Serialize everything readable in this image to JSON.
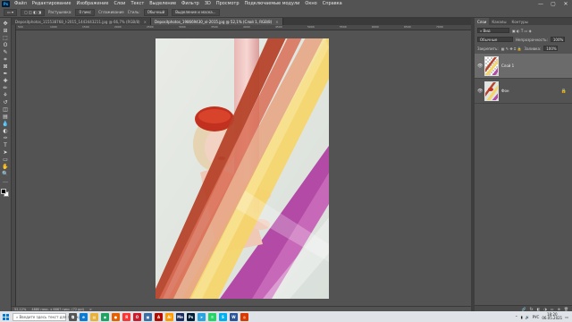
{
  "app": {
    "logo": "Ps"
  },
  "menu": [
    "Файл",
    "Редактирование",
    "Изображение",
    "Слои",
    "Текст",
    "Выделение",
    "Фильтр",
    "3D",
    "Просмотр",
    "Подключаемые модули",
    "Окно",
    "Справка"
  ],
  "window_controls": [
    "minimize-icon",
    "maximize-icon",
    "close-icon"
  ],
  "options": {
    "tool_icon": "move-icon",
    "feather_label": "Растушевка:",
    "feather_value": "0 пикс",
    "antialias_label": "Сглаживание",
    "style_label": "Стиль:",
    "style_value": "Обычный",
    "select_mask": "Выделение и маска..."
  },
  "tabs": [
    {
      "label": "Depositphotos_115538768_l-2015_1443443211.jpg @ 66,7% (RGB/8)",
      "active": false
    },
    {
      "label": "Depositphotos_198669430_xl-2015.jpg @ 52,1% (Слой 1, RGB/8)",
      "active": true
    }
  ],
  "ruler": [
    "500",
    "1000",
    "1500",
    "2000",
    "2500",
    "3000",
    "3500",
    "4000",
    "4500",
    "5000",
    "5500",
    "6000",
    "6500",
    "7000"
  ],
  "tools": [
    "move-icon",
    "artboard-icon",
    "marquee-icon",
    "lasso-icon",
    "quick-select-icon",
    "crop-icon",
    "frame-icon",
    "eyedropper-icon",
    "spot-heal-icon",
    "brush-icon",
    "stamp-icon",
    "history-brush-icon",
    "eraser-icon",
    "gradient-icon",
    "blur-icon",
    "dodge-icon",
    "pen-icon",
    "type-icon",
    "path-select-icon",
    "rectangle-icon",
    "hand-icon",
    "zoom-icon",
    "more-tools-icon"
  ],
  "tool_glyphs": [
    "✥",
    "⊞",
    "⬚",
    "ʘ",
    "✎",
    "⌗",
    "⊠",
    "✒",
    "✚",
    "✏",
    "⚘",
    "↺",
    "◫",
    "▤",
    "💧",
    "◐",
    "✑",
    "T",
    "➤",
    "▭",
    "✋",
    "🔍",
    "…"
  ],
  "status": {
    "zoom": "52,12%",
    "doc_size": "4880 пикс. x 6667 пикс. (72 ppi)",
    "arrow": ">"
  },
  "panel": {
    "tabs": [
      "Слои",
      "Каналы",
      "Контуры"
    ],
    "filter_label": "Вид",
    "blend_mode": "Обычные",
    "opacity_label": "Непрозрачность:",
    "opacity_value": "100%",
    "lock_label": "Закрепить:",
    "fill_label": "Заливка:",
    "fill_value": "100%",
    "layers": [
      {
        "name": "Слой 1",
        "selected": true,
        "locked": false
      },
      {
        "name": "Фон",
        "selected": false,
        "locked": true
      }
    ],
    "bottom_icons": [
      "link-icon",
      "fx-icon",
      "mask-icon",
      "adjustment-icon",
      "folder-icon",
      "new-layer-icon",
      "trash-icon"
    ],
    "bottom_glyphs": [
      "🔗",
      "fx",
      "◧",
      "◑",
      "▭",
      "⊕",
      "🗑"
    ]
  },
  "taskbar": {
    "search_placeholder": "Введите здесь текст для поиска",
    "apps": [
      {
        "icon": "task-view-icon",
        "letter": "⧉",
        "color": "#555555"
      },
      {
        "icon": "edge-icon",
        "letter": "e",
        "color": "#0c7bd1"
      },
      {
        "icon": "explorer-icon",
        "letter": "▤",
        "color": "#e8b23a"
      },
      {
        "icon": "chrome-icon",
        "letter": "◉",
        "color": "#1ea362"
      },
      {
        "icon": "firefox-icon",
        "letter": "●",
        "color": "#e66000"
      },
      {
        "icon": "yandex-icon",
        "letter": "Я",
        "color": "#ff3333"
      },
      {
        "icon": "opera-icon",
        "letter": "O",
        "color": "#cc1b2b"
      },
      {
        "icon": "files-icon",
        "letter": "▣",
        "color": "#3b6ea5"
      },
      {
        "icon": "acrobat-icon",
        "letter": "A",
        "color": "#b30b00"
      },
      {
        "icon": "illustrator-icon",
        "letter": "Ai",
        "color": "#ff9a00"
      },
      {
        "icon": "media-encoder-icon",
        "letter": "Me",
        "color": "#1b2e5f"
      },
      {
        "icon": "photoshop-icon",
        "letter": "Ps",
        "color": "#001e36"
      },
      {
        "icon": "telegram-icon",
        "letter": "➤",
        "color": "#2aa3df"
      },
      {
        "icon": "whatsapp-icon",
        "letter": "✆",
        "color": "#25d366"
      },
      {
        "icon": "skype-icon",
        "letter": "S",
        "color": "#00aff0"
      },
      {
        "icon": "word-icon",
        "letter": "W",
        "color": "#2b579a"
      },
      {
        "icon": "screen-recorder-icon",
        "letter": "◎",
        "color": "#d83b01"
      }
    ],
    "lang": "РУС",
    "time": "18:20",
    "date": "06.05.2021"
  }
}
